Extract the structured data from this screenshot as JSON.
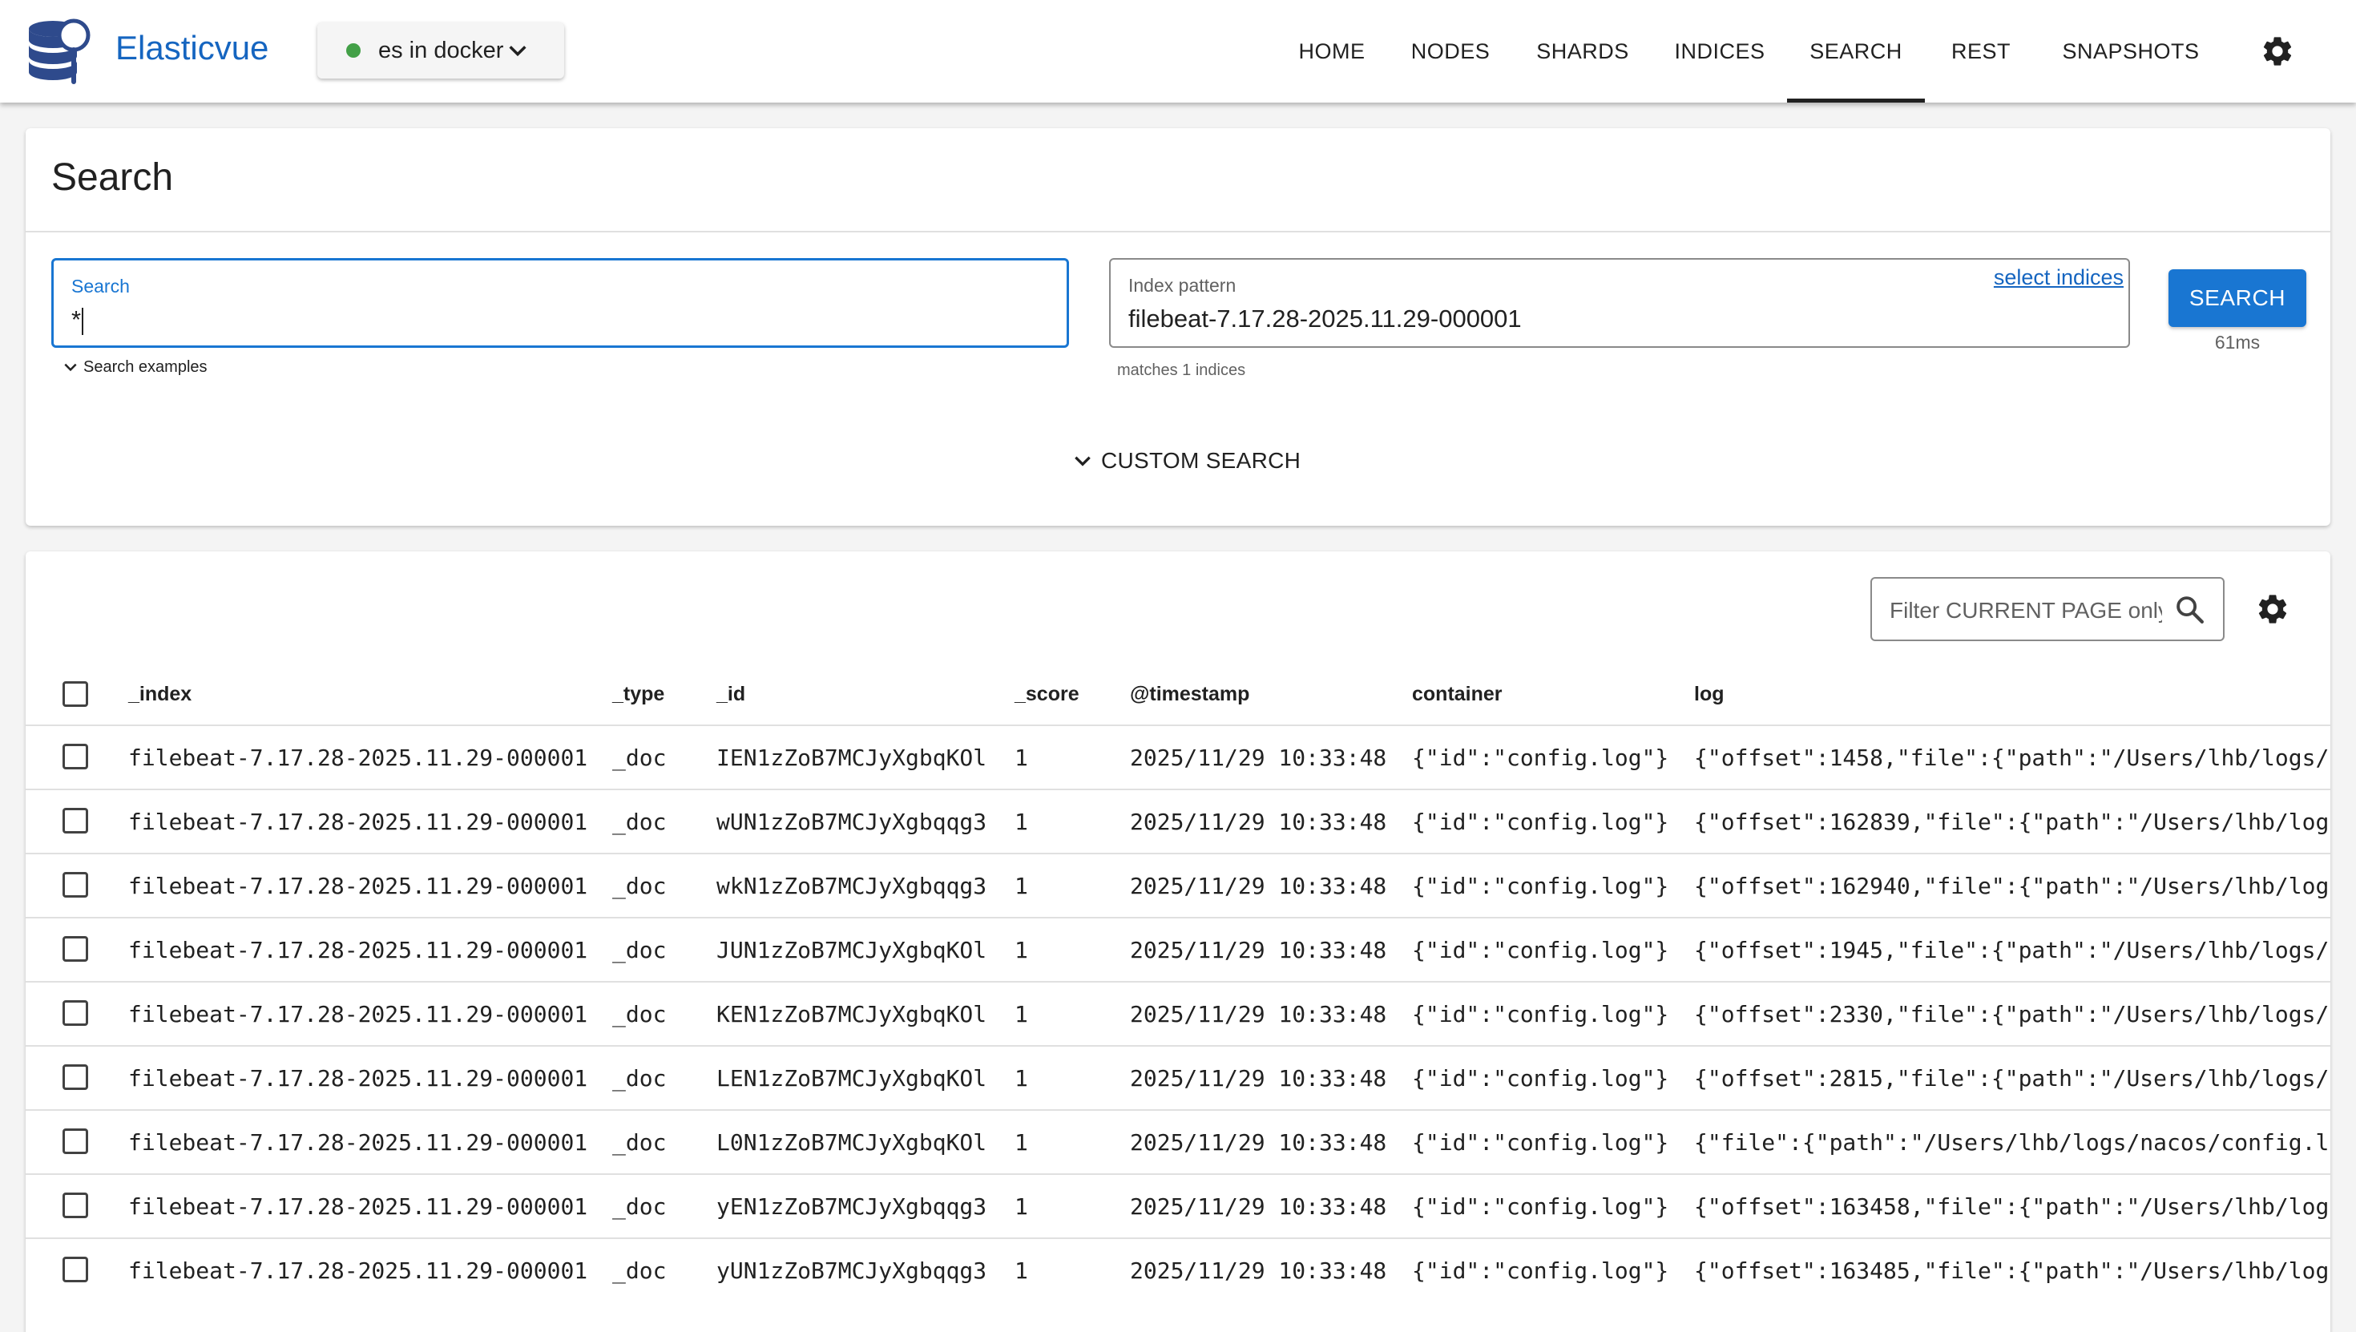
{
  "header": {
    "brand": "Elasticvue",
    "cluster": {
      "name": "es in docker",
      "status_color": "#43a047"
    },
    "nav": [
      {
        "label": "HOME",
        "active": false
      },
      {
        "label": "NODES",
        "active": false
      },
      {
        "label": "SHARDS",
        "active": false
      },
      {
        "label": "INDICES",
        "active": false
      },
      {
        "label": "SEARCH",
        "active": true
      },
      {
        "label": "REST",
        "active": false
      },
      {
        "label": "SNAPSHOTS",
        "active": false
      }
    ]
  },
  "search_card": {
    "title": "Search",
    "search_field": {
      "label": "Search",
      "value": "*"
    },
    "search_examples_label": "Search examples",
    "index_field": {
      "label": "Index pattern",
      "value": "filebeat-7.17.28-2025.11.29-000001",
      "link": "select indices"
    },
    "matches_text": "matches 1 indices",
    "search_button": "SEARCH",
    "timing": "61ms",
    "custom_search": "CUSTOM SEARCH"
  },
  "results": {
    "filter_placeholder": "Filter CURRENT PAGE only",
    "columns": [
      "_index",
      "_type",
      "_id",
      "_score",
      "@timestamp",
      "container",
      "log"
    ],
    "rows": [
      {
        "index": "filebeat-7.17.28-2025.11.29-000001",
        "type": "_doc",
        "id": "IEN1zZoB7MCJyXgbqKOl",
        "score": "1",
        "timestamp": "2025/11/29 10:33:48",
        "container": "{\"id\":\"config.log\"}",
        "log": "{\"offset\":1458,\"file\":{\"path\":\"/Users/lhb/logs/"
      },
      {
        "index": "filebeat-7.17.28-2025.11.29-000001",
        "type": "_doc",
        "id": "wUN1zZoB7MCJyXgbqqg3",
        "score": "1",
        "timestamp": "2025/11/29 10:33:48",
        "container": "{\"id\":\"config.log\"}",
        "log": "{\"offset\":162839,\"file\":{\"path\":\"/Users/lhb/log"
      },
      {
        "index": "filebeat-7.17.28-2025.11.29-000001",
        "type": "_doc",
        "id": "wkN1zZoB7MCJyXgbqqg3",
        "score": "1",
        "timestamp": "2025/11/29 10:33:48",
        "container": "{\"id\":\"config.log\"}",
        "log": "{\"offset\":162940,\"file\":{\"path\":\"/Users/lhb/log"
      },
      {
        "index": "filebeat-7.17.28-2025.11.29-000001",
        "type": "_doc",
        "id": "JUN1zZoB7MCJyXgbqKOl",
        "score": "1",
        "timestamp": "2025/11/29 10:33:48",
        "container": "{\"id\":\"config.log\"}",
        "log": "{\"offset\":1945,\"file\":{\"path\":\"/Users/lhb/logs/"
      },
      {
        "index": "filebeat-7.17.28-2025.11.29-000001",
        "type": "_doc",
        "id": "KEN1zZoB7MCJyXgbqKOl",
        "score": "1",
        "timestamp": "2025/11/29 10:33:48",
        "container": "{\"id\":\"config.log\"}",
        "log": "{\"offset\":2330,\"file\":{\"path\":\"/Users/lhb/logs/"
      },
      {
        "index": "filebeat-7.17.28-2025.11.29-000001",
        "type": "_doc",
        "id": "LEN1zZoB7MCJyXgbqKOl",
        "score": "1",
        "timestamp": "2025/11/29 10:33:48",
        "container": "{\"id\":\"config.log\"}",
        "log": "{\"offset\":2815,\"file\":{\"path\":\"/Users/lhb/logs/"
      },
      {
        "index": "filebeat-7.17.28-2025.11.29-000001",
        "type": "_doc",
        "id": "L0N1zZoB7MCJyXgbqKOl",
        "score": "1",
        "timestamp": "2025/11/29 10:33:48",
        "container": "{\"id\":\"config.log\"}",
        "log": "{\"file\":{\"path\":\"/Users/lhb/logs/nacos/config.l"
      },
      {
        "index": "filebeat-7.17.28-2025.11.29-000001",
        "type": "_doc",
        "id": "yEN1zZoB7MCJyXgbqqg3",
        "score": "1",
        "timestamp": "2025/11/29 10:33:48",
        "container": "{\"id\":\"config.log\"}",
        "log": "{\"offset\":163458,\"file\":{\"path\":\"/Users/lhb/log"
      },
      {
        "index": "filebeat-7.17.28-2025.11.29-000001",
        "type": "_doc",
        "id": "yUN1zZoB7MCJyXgbqqg3",
        "score": "1",
        "timestamp": "2025/11/29 10:33:48",
        "container": "{\"id\":\"config.log\"}",
        "log": "{\"offset\":163485,\"file\":{\"path\":\"/Users/lhb/log"
      }
    ]
  },
  "colors": {
    "accent": "#1976d2",
    "brand": "#1565c0",
    "logo": "#2e4a8c"
  },
  "icons": {
    "logo": "database-magnifier-icon",
    "settings": "gear-icon",
    "filter": "search-icon",
    "dropdown": "chevron-down-icon"
  }
}
